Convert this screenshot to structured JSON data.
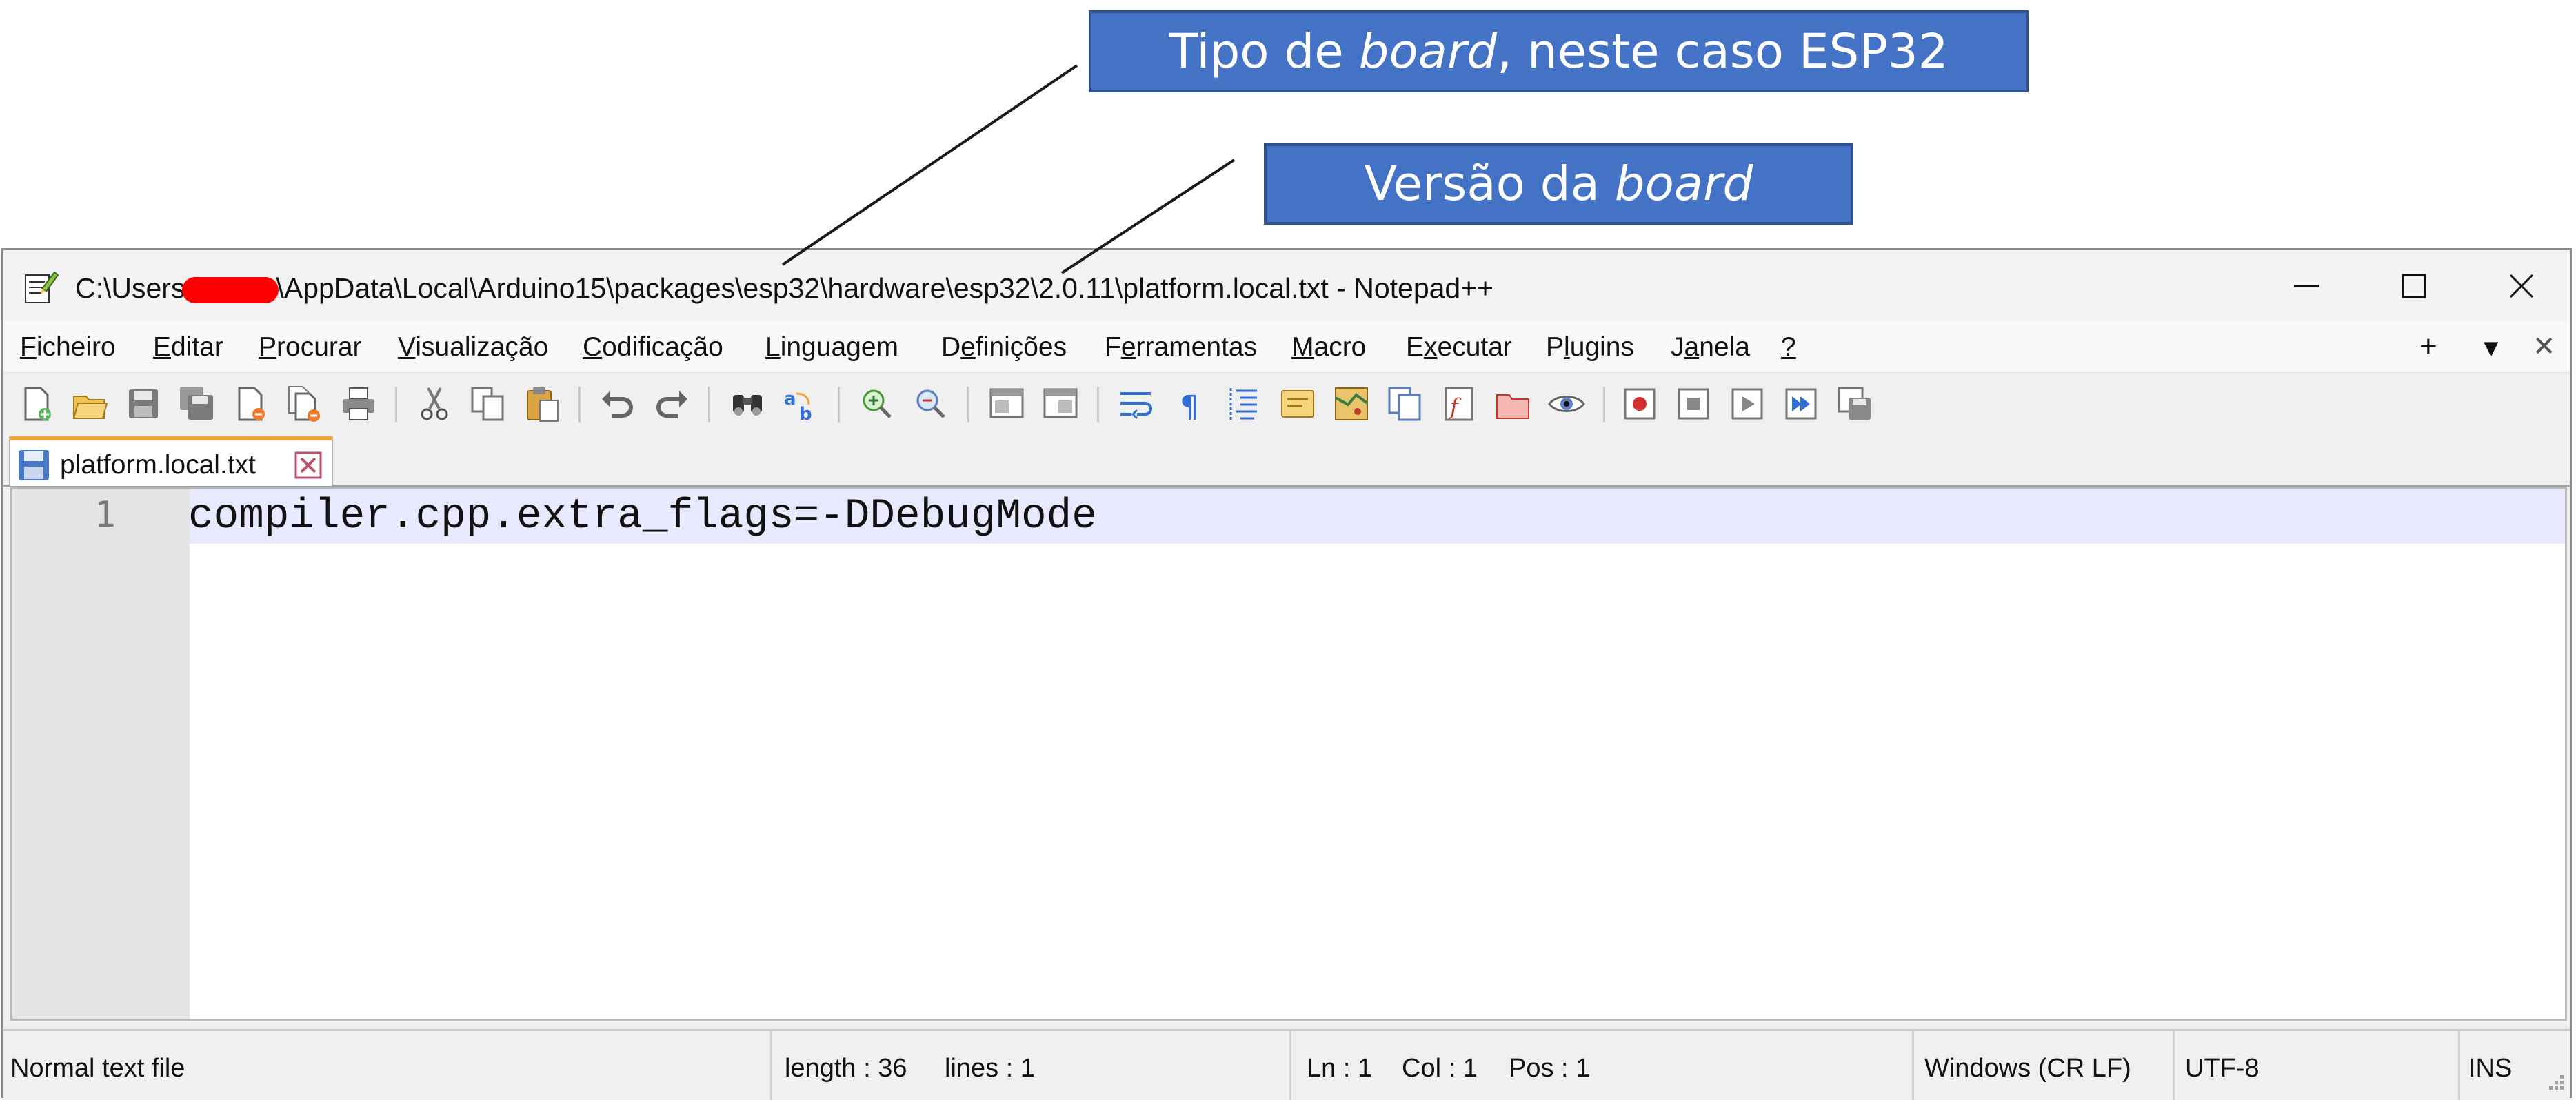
{
  "annotations": {
    "board_type": {
      "prefix": "Tipo de ",
      "emph": "board",
      "suffix": ", neste caso ESP32"
    },
    "board_version": {
      "prefix": "Versão da ",
      "emph": "board"
    }
  },
  "window": {
    "title_before_redaction": "C:\\Users",
    "title_after_redaction": "\\AppData\\Local\\Arduino15\\packages\\esp32\\hardware\\esp32\\2.0.11\\platform.local.txt - Notepad++",
    "controls": [
      "minimize-icon",
      "maximize-icon",
      "close-icon"
    ]
  },
  "menu": {
    "items": [
      {
        "u": "F",
        "rest": "icheiro"
      },
      {
        "u": "E",
        "rest": "ditar"
      },
      {
        "u": "P",
        "rest": "rocurar"
      },
      {
        "u": "V",
        "rest": "isualização"
      },
      {
        "u": "C",
        "rest": "odificação"
      },
      {
        "u": "L",
        "rest": "inguagem"
      },
      {
        "pre": "D",
        "u": "e",
        "rest": "finições"
      },
      {
        "pre": "F",
        "u": "e",
        "rest": "rramentas"
      },
      {
        "u": "M",
        "rest": "acro"
      },
      {
        "pre": "E",
        "u": "x",
        "rest": "ecutar"
      },
      {
        "pre": "P",
        "u": "l",
        "rest": "ugins"
      },
      {
        "pre": "J",
        "u": "a",
        "rest": "nela"
      },
      {
        "u": "?",
        "rest": ""
      }
    ],
    "right_controls": {
      "plus": "+",
      "dropdown": "▼",
      "close": "✕"
    }
  },
  "toolbar": {
    "icons": [
      "new-file-icon",
      "open-file-icon",
      "save-icon",
      "save-all-icon",
      "close-file-icon",
      "close-all-icon",
      "print-icon",
      "cut-icon",
      "copy-icon",
      "paste-icon",
      "undo-icon",
      "redo-icon",
      "find-icon",
      "replace-icon",
      "zoom-in-icon",
      "zoom-out-icon",
      "sync-vertical-icon",
      "sync-horizontal-icon",
      "word-wrap-icon",
      "show-all-chars-icon",
      "indent-guide-icon",
      "udl-icon",
      "doc-map-icon",
      "doc-list-icon",
      "function-list-icon",
      "folder-workspace-icon",
      "monitoring-icon",
      "record-macro-icon",
      "stop-macro-icon",
      "play-macro-icon",
      "run-macro-multiple-icon",
      "save-macro-icon"
    ]
  },
  "tab": {
    "label": "platform.local.txt"
  },
  "editor": {
    "line_number": "1",
    "code": "compiler.cpp.extra_flags=-DDebugMode"
  },
  "status": {
    "file_type": "Normal text file",
    "length": "length : 36",
    "lines": "lines : 1",
    "ln": "Ln : 1",
    "col": "Col : 1",
    "pos": "Pos : 1",
    "eol": "Windows (CR LF)",
    "encoding": "UTF-8",
    "mode": "INS"
  }
}
